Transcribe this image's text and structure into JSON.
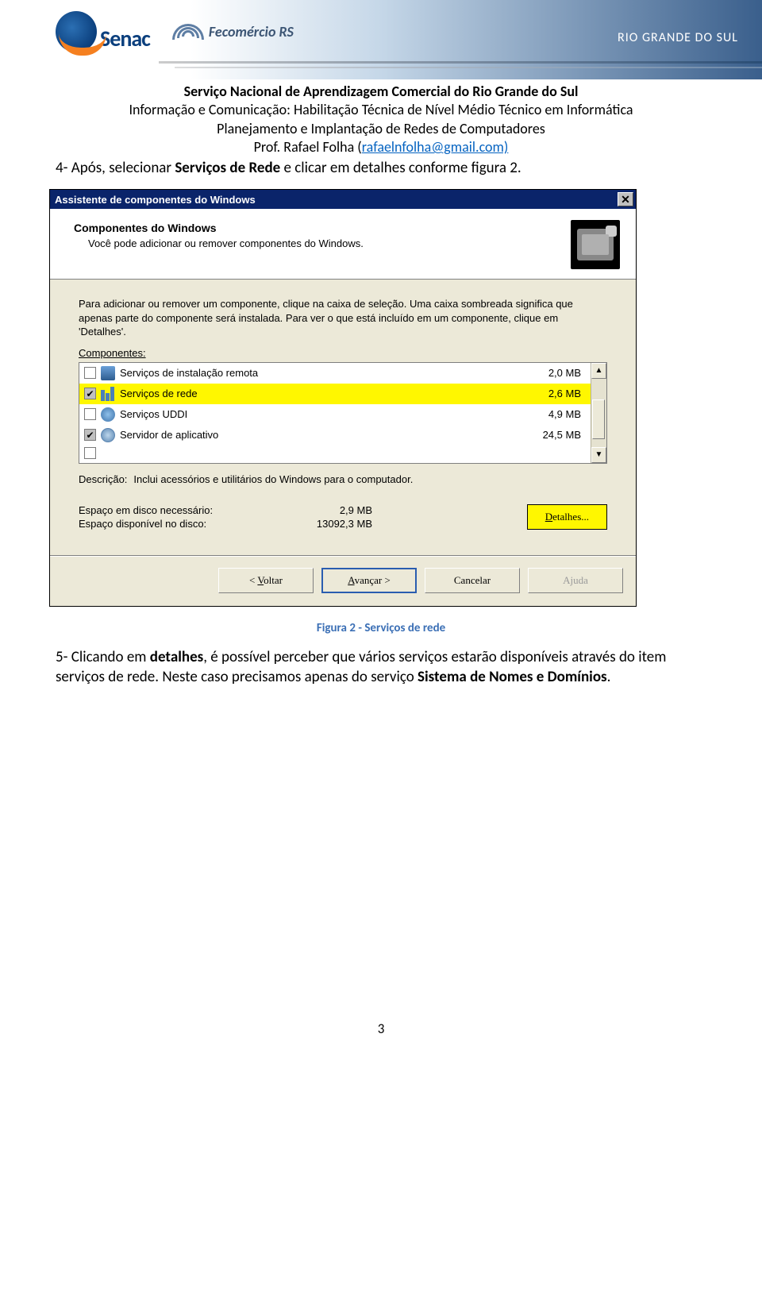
{
  "header_banner": {
    "senac_text": "Senac",
    "fecom_text": "Fecomércio RS",
    "rgs_text": "RIO GRANDE DO SUL"
  },
  "doc_header": {
    "line1": "Serviço Nacional de Aprendizagem Comercial do Rio Grande do Sul",
    "line2": "Informação e Comunicação: Habilitação Técnica de Nível Médio Técnico em Informática",
    "line3": "Planejamento e Implantação de Redes de Computadores",
    "line4_prefix": "Prof. Rafael Folha (",
    "line4_link": "rafaelnfolha@gmail.com)"
  },
  "step4": {
    "num": "4-",
    "before": " Após, selecionar ",
    "bold": "Serviços de Rede",
    "after": " e clicar em detalhes conforme figura 2."
  },
  "dialog": {
    "title": "Assistente de componentes do Windows",
    "close": "✕",
    "wiz_title": "Componentes do Windows",
    "wiz_sub": "Você pode adicionar ou remover componentes do Windows.",
    "instr": "Para adicionar ou remover um componente, clique na caixa de seleção. Uma caixa sombreada significa que apenas parte do componente será instalada. Para ver o que está incluído em um componente, clique em 'Detalhes'.",
    "components_label": "Componentes:",
    "rows": [
      {
        "name": "Serviços de instalação remota",
        "size": "2,0 MB",
        "checked": false,
        "partial": false,
        "sel": false,
        "icon": "icon-remote"
      },
      {
        "name": "Serviços de rede",
        "size": "2,6 MB",
        "checked": true,
        "partial": true,
        "sel": true,
        "icon": "icon-net"
      },
      {
        "name": "Serviços UDDI",
        "size": "4,9 MB",
        "checked": false,
        "partial": false,
        "sel": false,
        "icon": "icon-uddi"
      },
      {
        "name": "Servidor de aplicativo",
        "size": "24,5 MB",
        "checked": true,
        "partial": true,
        "sel": false,
        "icon": "icon-appsrv"
      }
    ],
    "desc_label": "Descrição:",
    "desc_text": "Inclui acessórios e utilitários do Windows para o computador.",
    "disk_req_label": "Espaço em disco necessário:",
    "disk_req_val": "2,9 MB",
    "disk_avail_label": "Espaço disponível no disco:",
    "disk_avail_val": "13092,3 MB",
    "details_btn": "Detalhes...",
    "btn_back": "< Voltar",
    "btn_next": "Avançar >",
    "btn_cancel": "Cancelar",
    "btn_help": "Ajuda"
  },
  "fig_caption": "Figura 2 - Serviços de rede",
  "step5": {
    "num": "5-",
    "t1": " Clicando em ",
    "b1": "detalhes",
    "t2": ", é possível perceber que vários serviços estarão disponíveis através do item serviços de rede. Neste caso precisamos apenas do serviço ",
    "b2": "Sistema de Nomes e Domínios",
    "t3": "."
  },
  "page_num": "3"
}
